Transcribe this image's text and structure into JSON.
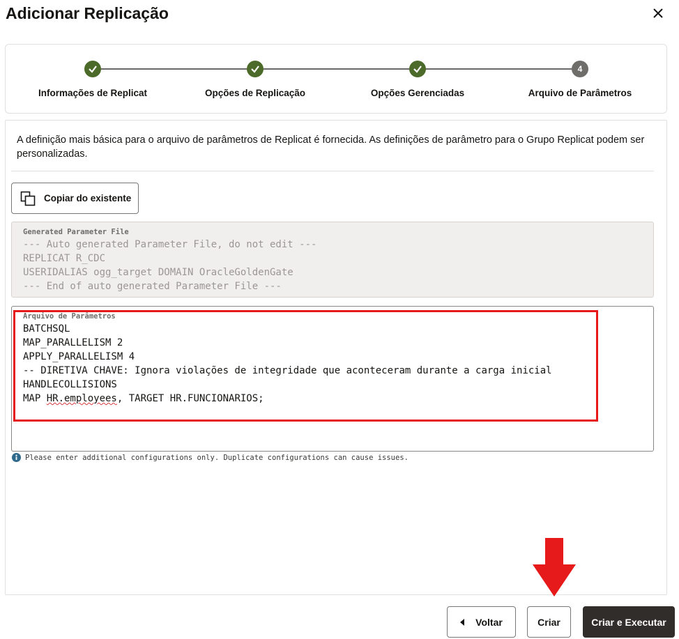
{
  "dialog": {
    "title": "Adicionar Replicação"
  },
  "stepper": {
    "steps": [
      {
        "label": "Informações de Replicat",
        "state": "done"
      },
      {
        "label": "Opções de Replicação",
        "state": "done"
      },
      {
        "label": "Opções Gerenciadas",
        "state": "done"
      },
      {
        "label": "Arquivo de Parâmetros",
        "state": "current",
        "number": "4"
      }
    ]
  },
  "content": {
    "description": "A definição mais básica para o arquivo de parâmetros de Replicat é fornecida. As definições de parâmetro para o Grupo Replicat podem ser personalizadas.",
    "copy_button_label": "Copiar do existente",
    "generated": {
      "label": "Generated Parameter File",
      "lines": [
        "--- Auto generated Parameter File, do not edit ---",
        "REPLICAT R_CDC",
        "USERIDALIAS ogg_target DOMAIN OracleGoldenGate",
        "--- End of auto generated Parameter File ---"
      ]
    },
    "params": {
      "label": "Arquivo de Parâmetros",
      "lines": [
        "BATCHSQL",
        "MAP_PARALLELISM 2",
        "APPLY_PARALLELISM 4",
        "-- DIRETIVA CHAVE: Ignora violações de integridade que aconteceram durante a carga inicial",
        "HANDLECOLLISIONS"
      ],
      "map_prefix": "MAP ",
      "map_misspelled": "HR.employees",
      "map_suffix": ", TARGET HR.FUNCIONARIOS;"
    },
    "hint": "Please enter additional configurations only. Duplicate configurations can cause issues."
  },
  "footer": {
    "back_label": "Voltar",
    "create_label": "Criar",
    "create_run_label": "Criar e Executar"
  },
  "colors": {
    "step_done": "#4c6b2a",
    "highlight": "#e61a1a",
    "primary_button": "#312d2a"
  }
}
